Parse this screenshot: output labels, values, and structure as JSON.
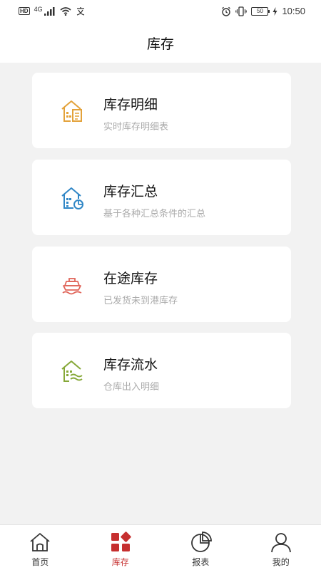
{
  "status_bar": {
    "network_badge": "HD",
    "network_type": "4G",
    "battery": "50",
    "time": "10:50"
  },
  "header": {
    "title": "库存"
  },
  "cards": [
    {
      "title": "库存明细",
      "subtitle": "实时库存明细表",
      "icon": "warehouse-detail-icon",
      "color": "#e3a23a"
    },
    {
      "title": "库存汇总",
      "subtitle": "基于各种汇总条件的汇总",
      "icon": "warehouse-summary-icon",
      "color": "#2f86c6"
    },
    {
      "title": "在途库存",
      "subtitle": "已发货未到港库存",
      "icon": "ship-icon",
      "color": "#e0655a"
    },
    {
      "title": "库存流水",
      "subtitle": "仓库出入明细",
      "icon": "warehouse-flow-icon",
      "color": "#86a838"
    }
  ],
  "tabs": [
    {
      "label": "首页",
      "icon": "home-icon",
      "active": false
    },
    {
      "label": "库存",
      "icon": "grid-icon",
      "active": true
    },
    {
      "label": "报表",
      "icon": "pie-chart-icon",
      "active": false
    },
    {
      "label": "我的",
      "icon": "user-icon",
      "active": false
    }
  ],
  "colors": {
    "accent": "#c62f2f",
    "background": "#f2f2f2"
  }
}
